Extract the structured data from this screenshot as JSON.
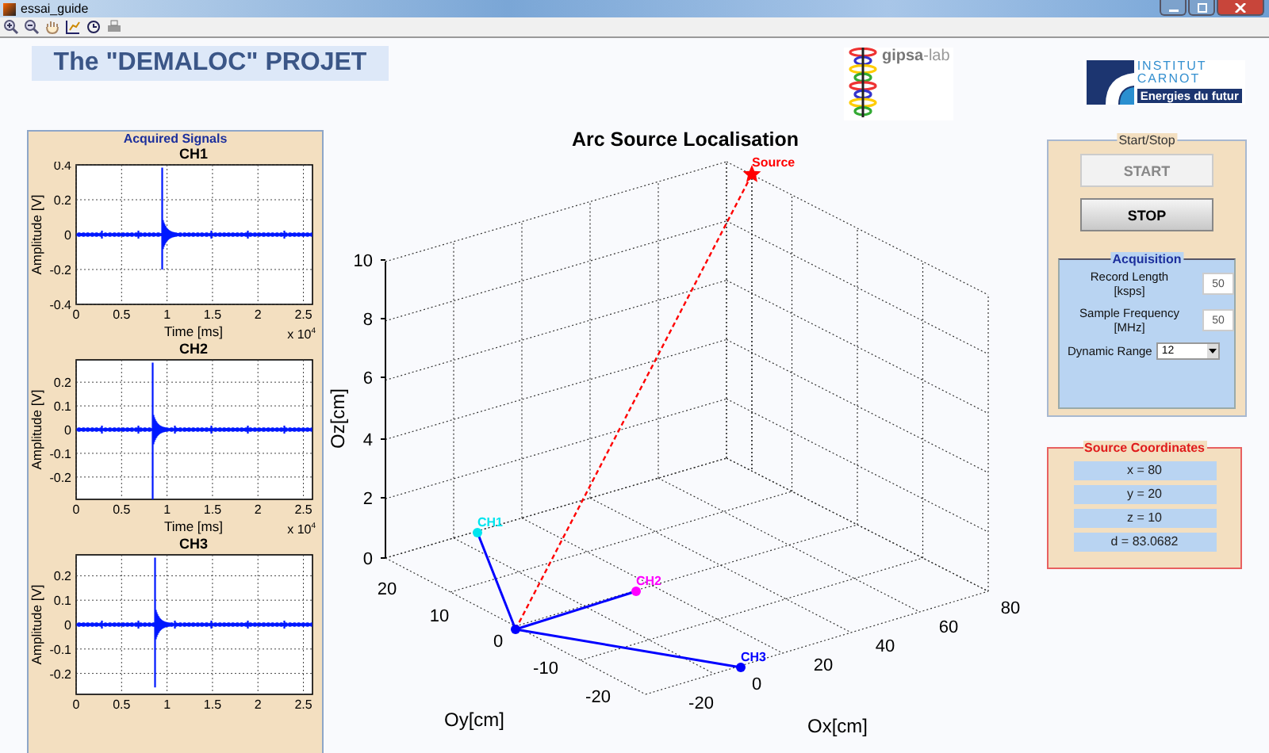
{
  "window": {
    "title": "essai_guide"
  },
  "header": {
    "title": "The \"DEMALOC\" PROJET",
    "lab_logo": "**gipsa**-lab",
    "institute_logo": {
      "line_1": "INSTITUT",
      "line_2": "CARNOT",
      "tagline": "Energies du futur"
    }
  },
  "signals": {
    "title": "Acquired Signals",
    "plots": [
      {
        "title": "CH1",
        "ylabel": "Amplitude [V]",
        "yticks": [
          "0.4",
          "0.2",
          "0",
          "-0.2",
          "-0.4"
        ],
        "xticks": [
          "0",
          "0.5",
          "1",
          "1.5",
          "2",
          "2.5"
        ],
        "xlabel": "Time [ms]",
        "x_multiplier": "x 10$^{4}$"
      },
      {
        "title": "CH2",
        "ylabel": "Amplitude [V]",
        "yticks": [
          "0.2",
          "0.1",
          "0",
          "-0.1",
          "-0.2"
        ],
        "xticks": [
          "0",
          "0.5",
          "1",
          "1.5",
          "2",
          "2.5"
        ],
        "xlabel": "Time [ms]",
        "x_multiplier": "x 10$^{4}$"
      },
      {
        "title": "CH3",
        "ylabel": "Amplitude [V]",
        "yticks": [
          "0.2",
          "0.1",
          "0",
          "-0.1",
          "-0.2"
        ],
        "xticks": [
          "0",
          "0.5",
          "1",
          "1.5",
          "2",
          "2.5"
        ]
      }
    ]
  },
  "localisation": {
    "title": "Arc Source Localisation",
    "z_label": "Oz[cm]",
    "y_label": "Oy[cm]",
    "x_label": "Ox[cm]",
    "zticks": [
      "10",
      "8",
      "6",
      "4",
      "2",
      "0"
    ],
    "yticks": [
      "20",
      "10",
      "0",
      "-10",
      "-20"
    ],
    "xticks": [
      "-20",
      "0",
      "20",
      "40",
      "60",
      "80"
    ],
    "points": [
      {
        "kind": "star",
        "label": "Source",
        "color": "#ff0000"
      },
      {
        "kind": "dot",
        "label": "CH1",
        "color": "#00e5ee"
      },
      {
        "kind": "dot",
        "label": "CH2",
        "color": "#ff00ff"
      },
      {
        "kind": "dot",
        "label": "CH3",
        "color": "#0000ff"
      }
    ]
  },
  "start_stop": {
    "title": "Start/Stop",
    "buttons": [
      {
        "label": "START",
        "disabled": true
      },
      {
        "label": "STOP",
        "disabled": false
      }
    ]
  },
  "acquisition": {
    "title": "Acquisition",
    "fields": [
      {
        "kind": "input",
        "label": "Record Length [ksps]",
        "value": "50"
      },
      {
        "kind": "input",
        "label": "Sample Frequency [MHz]",
        "value": "50"
      },
      {
        "kind": "dropdown",
        "label": "Dynamic Range",
        "value": "12"
      }
    ]
  },
  "source_coordinates": {
    "title": "Source Coordinates",
    "values": [
      "x = 80",
      "y = 20",
      "z = 10",
      "d = 83.0682"
    ]
  }
}
